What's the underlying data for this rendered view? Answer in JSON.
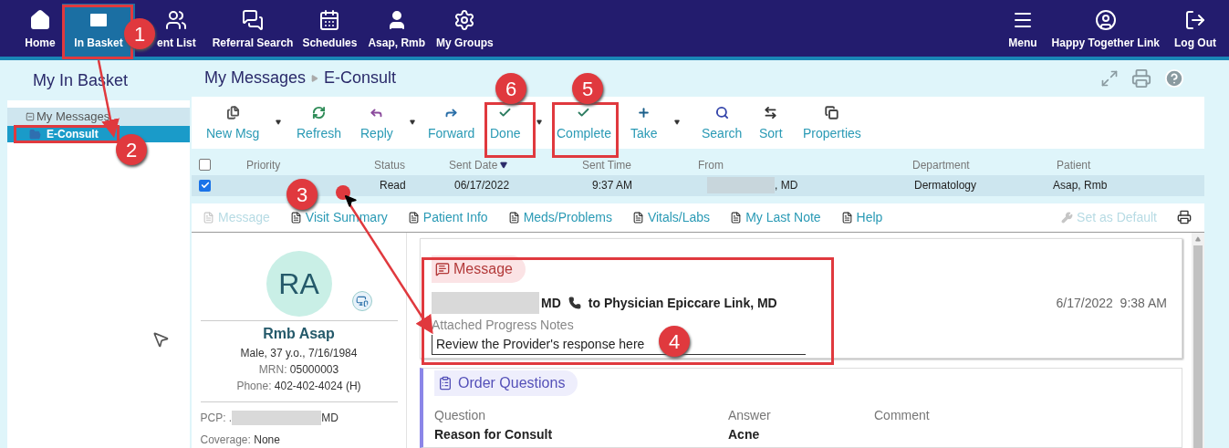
{
  "nav": {
    "left": [
      {
        "label": "Home",
        "selected": false
      },
      {
        "label": "In Basket",
        "selected": true
      },
      {
        "label": "ent List",
        "selected": false
      },
      {
        "label": "Referral Search",
        "selected": false
      },
      {
        "label": "Schedules",
        "selected": false
      },
      {
        "label": "Asap, Rmb",
        "selected": false
      },
      {
        "label": "My Groups",
        "selected": false
      }
    ],
    "right": [
      {
        "label": "Menu",
        "selected": false
      },
      {
        "label": "Happy Together Link",
        "selected": false
      },
      {
        "label": "Log Out",
        "selected": false
      }
    ]
  },
  "sidebar": {
    "title": "My In Basket",
    "tree": [
      {
        "label": "My Messages",
        "expanded": true,
        "children": [
          {
            "label": "E-Consult",
            "selected": true
          }
        ]
      }
    ]
  },
  "breadcrumb": [
    "My Messages",
    "E-Consult"
  ],
  "toolbar": [
    {
      "label": "New Msg",
      "dropdown": true
    },
    {
      "label": "Refresh",
      "dropdown": false
    },
    {
      "label": "Reply",
      "dropdown": true
    },
    {
      "label": "Forward",
      "dropdown": false
    },
    {
      "label": "Done",
      "dropdown": true
    },
    {
      "label": "Complete",
      "dropdown": false
    },
    {
      "label": "Take",
      "dropdown": true
    },
    {
      "label": "Search",
      "dropdown": false
    },
    {
      "label": "Sort",
      "dropdown": false
    },
    {
      "label": "Properties",
      "dropdown": false
    }
  ],
  "table": {
    "all_checked": false,
    "columns": [
      {
        "label": "Priority",
        "sorted": false
      },
      {
        "label": "Status",
        "sorted": false
      },
      {
        "label": "Sent Date",
        "sorted": true
      },
      {
        "label": "Sent Time",
        "sorted": false
      },
      {
        "label": "From",
        "sorted": false
      },
      {
        "label": "Department",
        "sorted": false
      },
      {
        "label": "Patient",
        "sorted": false
      }
    ],
    "rows": [
      {
        "checked": true,
        "selected": true,
        "status": "Read",
        "sent_date": "06/17/2022",
        "sent_time": "9:37 AM",
        "from": ", MD",
        "department": "Dermatology",
        "patient": "Asap, Rmb"
      }
    ]
  },
  "tabs": [
    {
      "label": "Message",
      "disabled": true
    },
    {
      "label": "Visit Summary",
      "disabled": false
    },
    {
      "label": "Patient Info",
      "disabled": false
    },
    {
      "label": "Meds/Problems",
      "disabled": false
    },
    {
      "label": "Vitals/Labs",
      "disabled": false
    },
    {
      "label": "My Last Note",
      "disabled": false
    },
    {
      "label": "Help",
      "disabled": false
    }
  ],
  "set_default": {
    "label": "Set as Default",
    "disabled": true
  },
  "patient": {
    "initials": "RA",
    "name": "Rmb Asap",
    "demographics": "Male, 37 y.o., 7/16/1984",
    "mrn": {
      "label": "MRN:",
      "value": "05000003"
    },
    "phone": {
      "label": "Phone:",
      "value": "402-402-4024 (H)"
    },
    "pcp": {
      "label": "PCP: .",
      "value": "MD"
    },
    "coverage": {
      "label": "Coverage:",
      "value": "None"
    }
  },
  "message": {
    "title": "Message",
    "sender": "MD",
    "recipient": "to Physician Epiccare Link, MD",
    "datetime": "6/17/2022  9:38 AM",
    "note_title": "Attached Progress Notes",
    "note_text": "Review the Provider's response here"
  },
  "order_questions": {
    "title": "Order Questions",
    "columns": [
      "Question",
      "Answer",
      "Comment"
    ],
    "rows": [
      {
        "question": "Reason for Consult",
        "answer": "Acne"
      }
    ]
  },
  "annotations": [
    {
      "label": "1"
    },
    {
      "label": "2"
    },
    {
      "label": "3"
    },
    {
      "label": "4"
    },
    {
      "label": "5"
    },
    {
      "label": "6"
    }
  ]
}
